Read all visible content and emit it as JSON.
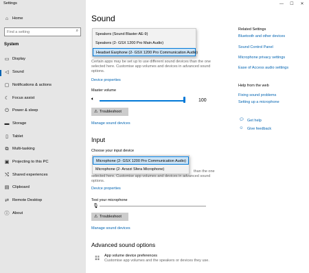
{
  "window": {
    "title": "Settings",
    "minimize": "—",
    "maximize": "☐",
    "close": "✕"
  },
  "sidebar": {
    "home_label": "Home",
    "search_placeholder": "Find a setting",
    "section_label": "System",
    "items": [
      {
        "label": "Display",
        "icon": "display-icon"
      },
      {
        "label": "Sound",
        "icon": "speaker-icon",
        "active": true
      },
      {
        "label": "Notifications & actions",
        "icon": "notifications-icon"
      },
      {
        "label": "Focus assist",
        "icon": "moon-icon"
      },
      {
        "label": "Power & sleep",
        "icon": "power-icon"
      },
      {
        "label": "Storage",
        "icon": "storage-icon"
      },
      {
        "label": "Tablet",
        "icon": "tablet-icon"
      },
      {
        "label": "Multi-tasking",
        "icon": "multitasking-icon"
      },
      {
        "label": "Projecting to this PC",
        "icon": "projecting-icon"
      },
      {
        "label": "Shared experiences",
        "icon": "shared-icon"
      },
      {
        "label": "Clipboard",
        "icon": "clipboard-icon"
      },
      {
        "label": "Remote Desktop",
        "icon": "remote-desktop-icon"
      },
      {
        "label": "About",
        "icon": "info-icon"
      }
    ]
  },
  "main": {
    "title": "Sound",
    "output_dropdown": {
      "options": [
        "Speakers (Sound Blaster AE-9)",
        "Speakers (2- GSX 1200 Pro Main Audio)",
        "Headset Earphone (2- GSX 1200 Pro Communication Audio)"
      ],
      "selected_index": 2
    },
    "output_desc": "Certain apps may be set up to use different sound devices than the one selected here. Customise app volumes and devices in advanced sound options.",
    "output_device_properties": "Device properties",
    "master_volume_label": "Master volume",
    "master_volume_value": "100",
    "master_volume_level": 100,
    "troubleshoot_label": "Troubleshoot",
    "manage_sound_devices": "Manage sound devices",
    "input_heading": "Input",
    "input_choose_label": "Choose your input device",
    "input_dropdown": {
      "options": [
        "Microphone (2- GSX 1200 Pro Communication Audio)",
        "Microphone (2- Arozzi Sfera Microphone)"
      ],
      "selected_index": 0
    },
    "input_desc_partial": "than the one",
    "input_desc_line2": "selected here. Customise app volumes and devices in advanced sound",
    "input_desc_line3": "options.",
    "input_device_properties": "Device properties",
    "test_mic_label": "Test your microphone",
    "input_troubleshoot_label": "Troubleshoot",
    "input_manage_sound_devices": "Manage sound devices",
    "advanced_heading": "Advanced sound options",
    "app_volume_title": "App volume  device preferences",
    "app_volume_desc": "Customise app volumes and the speakers or devices they use."
  },
  "related": {
    "heading": "Related Settings",
    "links": [
      "Bluetooth and other devices",
      "Sound Control Panel",
      "Microphone privacy settings",
      "Ease of Access audio settings"
    ],
    "help_heading": "Help from the web",
    "help_links": [
      "Fixing sound problems",
      "Setting up a microphone"
    ],
    "get_help": "Get help",
    "give_feedback": "Give feedback"
  },
  "colors": {
    "accent": "#0078d7",
    "link": "#0063b1",
    "sidebar_bg": "#e6e6e6"
  }
}
